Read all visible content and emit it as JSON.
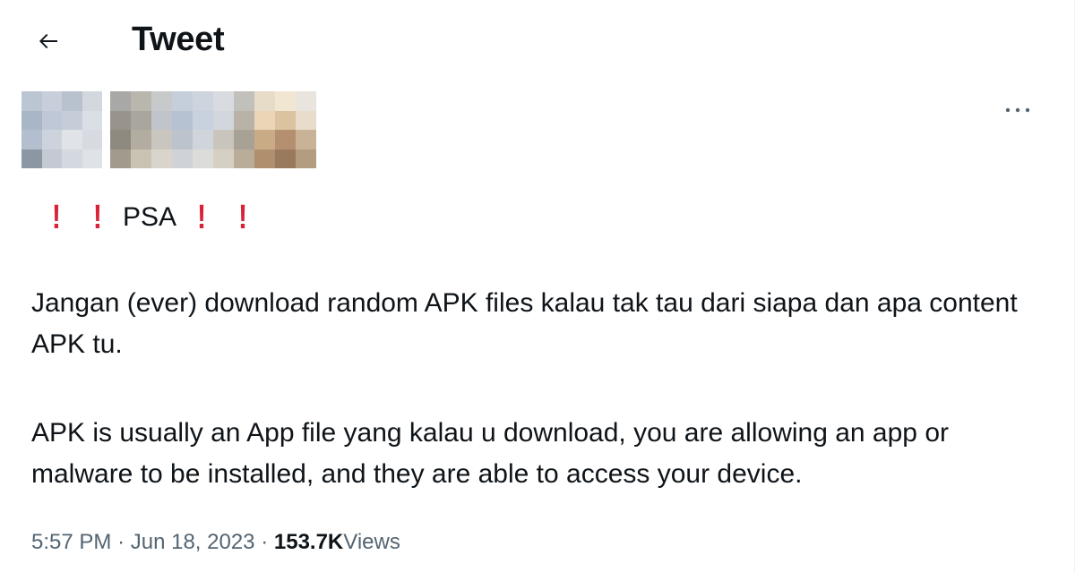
{
  "header": {
    "back_icon": "arrow-left-icon",
    "title": "Tweet"
  },
  "author": {
    "avatar_icon": "blurred-avatar",
    "name_icon": "blurred-name",
    "more_icon": "more-horizontal-icon"
  },
  "tweet": {
    "psa_label": "PSA",
    "psa_marker_icon": "red-exclamation-icon",
    "accent_color": "#d8223a",
    "paragraph_1": "Jangan (ever) download random APK files kalau tak tau dari siapa dan apa content APK tu.",
    "paragraph_2": "APK is usually an App file yang kalau u download, you are allowing an app or malware to be installed, and they are able to access your device."
  },
  "meta": {
    "time": "5:57 PM",
    "separator": "·",
    "date": "Jun 18, 2023",
    "views_count": "153.7K",
    "views_label": "Views"
  }
}
